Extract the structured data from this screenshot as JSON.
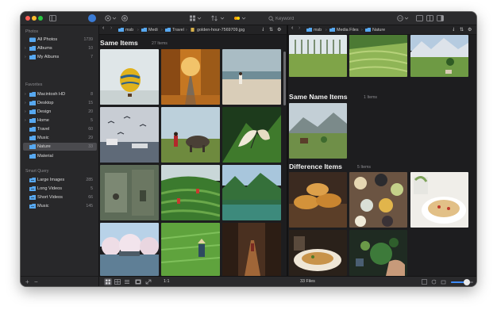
{
  "toolbar": {
    "search_placeholder": "Keyword",
    "icons": [
      "sidebar-toggle-icon",
      "user-avatar",
      "settings-icon",
      "add-icon",
      "view-mode-icon",
      "sort-icon",
      "tag-color-icon",
      "search-icon",
      "more-icon",
      "layout-single-icon",
      "layout-split-icon",
      "inspector-icon"
    ]
  },
  "sidebar": {
    "photos_title": "Photos",
    "photos": [
      {
        "label": "All Photos",
        "count": "1739",
        "selected": false
      },
      {
        "label": "Albums",
        "count": "10",
        "selected": false
      },
      {
        "label": "My Albums",
        "count": "7",
        "selected": false
      }
    ],
    "favorites_title": "Favorites",
    "favorites": [
      {
        "label": "Macintosh HD",
        "count": "8",
        "selected": false
      },
      {
        "label": "Desktop",
        "count": "15",
        "selected": false
      },
      {
        "label": "Design",
        "count": "20",
        "selected": false
      },
      {
        "label": "Home",
        "count": "5",
        "selected": false
      },
      {
        "label": "Travel",
        "count": "60",
        "selected": false
      },
      {
        "label": "Music",
        "count": "29",
        "selected": false
      },
      {
        "label": "Nature",
        "count": "33",
        "selected": true
      },
      {
        "label": "Material",
        "count": "",
        "selected": false
      }
    ],
    "smart_title": "Smart Query",
    "smart": [
      {
        "label": "Large Images",
        "count": "285"
      },
      {
        "label": "Long Videos",
        "count": "5"
      },
      {
        "label": "Short Videos",
        "count": "66"
      },
      {
        "label": "Music",
        "count": "145"
      }
    ],
    "footer_add": "+",
    "footer_remove": "−"
  },
  "left_pane": {
    "breadcrumb": [
      "msb",
      "Medi",
      "Travel",
      "golden-hour-7569709.jpg"
    ],
    "group_title": "Same Items",
    "group_count": "27 Items"
  },
  "right_pane": {
    "breadcrumb": [
      "msb",
      "Media Files",
      "Nature"
    ],
    "groups": [
      {
        "title": "Same Name Items",
        "count": "1 Items"
      },
      {
        "title": "Difference Items",
        "count": "5 Items"
      }
    ]
  },
  "status": {
    "zoom": "1:1",
    "file_count": "33 Files",
    "thumbnail_size_fraction": 0.72
  },
  "colors": {
    "accent": "#3d8bff",
    "folder": "#57a8f0",
    "window_bg": "#1f1f21",
    "sidebar_bg": "#28282a"
  }
}
